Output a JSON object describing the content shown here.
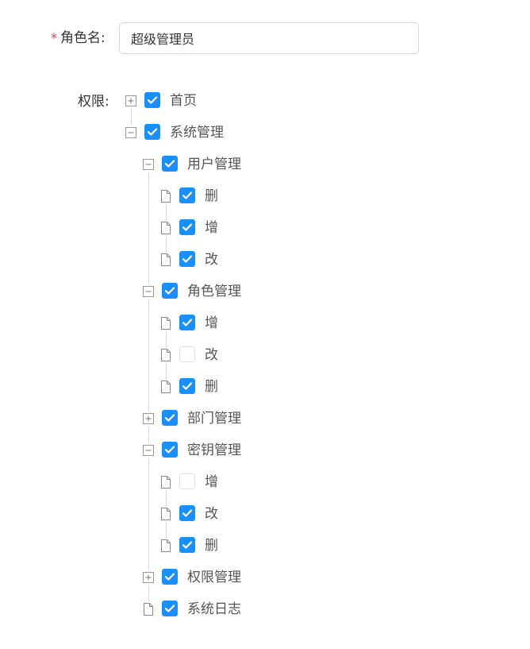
{
  "form": {
    "role_name_label": "角色名:",
    "required_mark": "*",
    "role_name_value": "超级管理员",
    "permissions_label": "权限:"
  },
  "colors": {
    "checkbox_checked": "#1890ff",
    "required_star": "#e2415b"
  },
  "icons": {
    "expanded": "minus-square-icon",
    "collapsed": "plus-square-icon",
    "leaf": "file-icon"
  },
  "permission_tree": [
    {
      "label": "首页",
      "checked": true,
      "toggle": "collapsed",
      "children": []
    },
    {
      "label": "系统管理",
      "checked": true,
      "toggle": "expanded",
      "children": [
        {
          "label": "用户管理",
          "checked": true,
          "toggle": "expanded",
          "children": [
            {
              "label": "删",
              "checked": true,
              "toggle": "leaf"
            },
            {
              "label": "增",
              "checked": true,
              "toggle": "leaf"
            },
            {
              "label": "改",
              "checked": true,
              "toggle": "leaf"
            }
          ]
        },
        {
          "label": "角色管理",
          "checked": true,
          "toggle": "expanded",
          "children": [
            {
              "label": "增",
              "checked": true,
              "toggle": "leaf"
            },
            {
              "label": "改",
              "checked": false,
              "toggle": "leaf"
            },
            {
              "label": "删",
              "checked": true,
              "toggle": "leaf"
            }
          ]
        },
        {
          "label": "部门管理",
          "checked": true,
          "toggle": "collapsed",
          "children": []
        },
        {
          "label": "密钥管理",
          "checked": true,
          "toggle": "expanded",
          "children": [
            {
              "label": "增",
              "checked": false,
              "toggle": "leaf"
            },
            {
              "label": "改",
              "checked": true,
              "toggle": "leaf"
            },
            {
              "label": "删",
              "checked": true,
              "toggle": "leaf"
            }
          ]
        },
        {
          "label": "权限管理",
          "checked": true,
          "toggle": "collapsed",
          "children": []
        },
        {
          "label": "系统日志",
          "checked": true,
          "toggle": "leaf",
          "children": []
        }
      ]
    }
  ]
}
